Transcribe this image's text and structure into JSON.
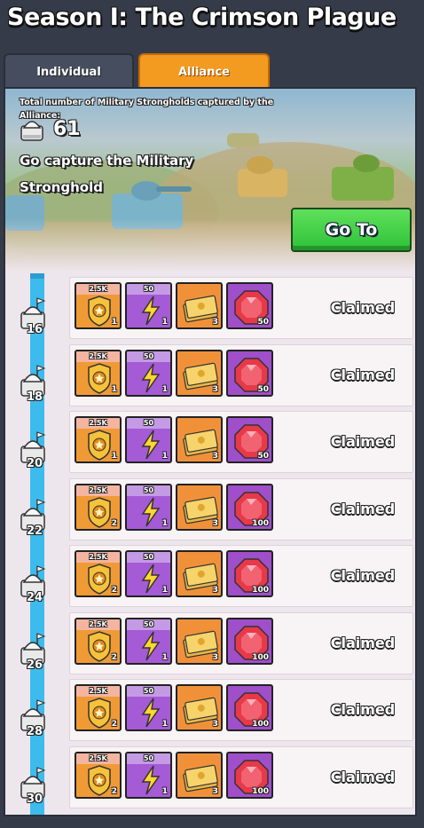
{
  "header": {
    "title": "Season I: The Crimson Plague"
  },
  "tabs": [
    {
      "label": "Individual",
      "active": false
    },
    {
      "label": "Alliance",
      "active": true
    }
  ],
  "banner": {
    "info_text": "Total number of Military Strongholds captured by the Alliance:",
    "stronghold_count": "61",
    "capture_text": "Go capture the Military Stronghold",
    "goto_label": "Go To"
  },
  "colors": {
    "accent_tab": "#f39a20",
    "goto_button": "#3ccf46",
    "progress": "#3dbbec"
  },
  "rewards": [
    {
      "milestone": "16",
      "badge_top": "2.5K",
      "badge_qty": "1",
      "energy_top": "50",
      "energy_qty": "1",
      "ticket_qty": "3",
      "gem_qty": "50",
      "status": "Claimed"
    },
    {
      "milestone": "18",
      "badge_top": "2.5K",
      "badge_qty": "1",
      "energy_top": "50",
      "energy_qty": "1",
      "ticket_qty": "3",
      "gem_qty": "50",
      "status": "Claimed"
    },
    {
      "milestone": "20",
      "badge_top": "2.5K",
      "badge_qty": "1",
      "energy_top": "50",
      "energy_qty": "1",
      "ticket_qty": "3",
      "gem_qty": "50",
      "status": "Claimed"
    },
    {
      "milestone": "22",
      "badge_top": "2.5K",
      "badge_qty": "2",
      "energy_top": "50",
      "energy_qty": "1",
      "ticket_qty": "3",
      "gem_qty": "100",
      "status": "Claimed"
    },
    {
      "milestone": "24",
      "badge_top": "2.5K",
      "badge_qty": "2",
      "energy_top": "50",
      "energy_qty": "1",
      "ticket_qty": "3",
      "gem_qty": "100",
      "status": "Claimed"
    },
    {
      "milestone": "26",
      "badge_top": "2.5K",
      "badge_qty": "2",
      "energy_top": "50",
      "energy_qty": "1",
      "ticket_qty": "3",
      "gem_qty": "100",
      "status": "Claimed"
    },
    {
      "milestone": "28",
      "badge_top": "2.5K",
      "badge_qty": "2",
      "energy_top": "50",
      "energy_qty": "1",
      "ticket_qty": "3",
      "gem_qty": "100",
      "status": "Claimed"
    },
    {
      "milestone": "30",
      "badge_top": "2.5K",
      "badge_qty": "2",
      "energy_top": "50",
      "energy_qty": "1",
      "ticket_qty": "3",
      "gem_qty": "100",
      "status": "Claimed"
    }
  ]
}
